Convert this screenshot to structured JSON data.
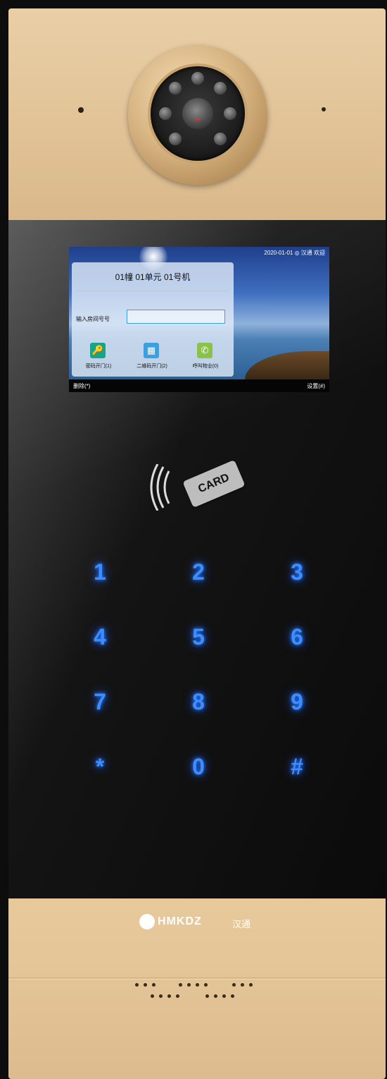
{
  "lcd": {
    "status_text": "2020-01-01 ◎ 汉通 欢迎",
    "title": "01幢 01单元 01号机",
    "input_label": "输入房间号号",
    "input_value": "",
    "buttons": [
      {
        "label": "密码开门(1)",
        "icon": "key-icon",
        "color": "#17a589",
        "glyph": "🔑"
      },
      {
        "label": "二维码开门(2)",
        "icon": "qrcode-icon",
        "color": "#3aa0e0",
        "glyph": "▦"
      },
      {
        "label": "呼叫物业(0)",
        "icon": "phone-icon",
        "color": "#8bc34a",
        "glyph": "✆"
      }
    ],
    "bottom_left": "删除(*)",
    "bottom_right": "设置(#)"
  },
  "rfid": {
    "card_label": "CARD",
    "icon": "nfc-waves-icon"
  },
  "keypad": {
    "keys": [
      "1",
      "2",
      "3",
      "4",
      "5",
      "6",
      "7",
      "8",
      "9",
      "*",
      "0",
      "#"
    ],
    "glow_color": "#3c8dff"
  },
  "brand": {
    "logo_text": "HMKDZ",
    "logo_cn": "汉通"
  },
  "colors": {
    "gold": "#e3c59a",
    "glass": "#111111"
  }
}
